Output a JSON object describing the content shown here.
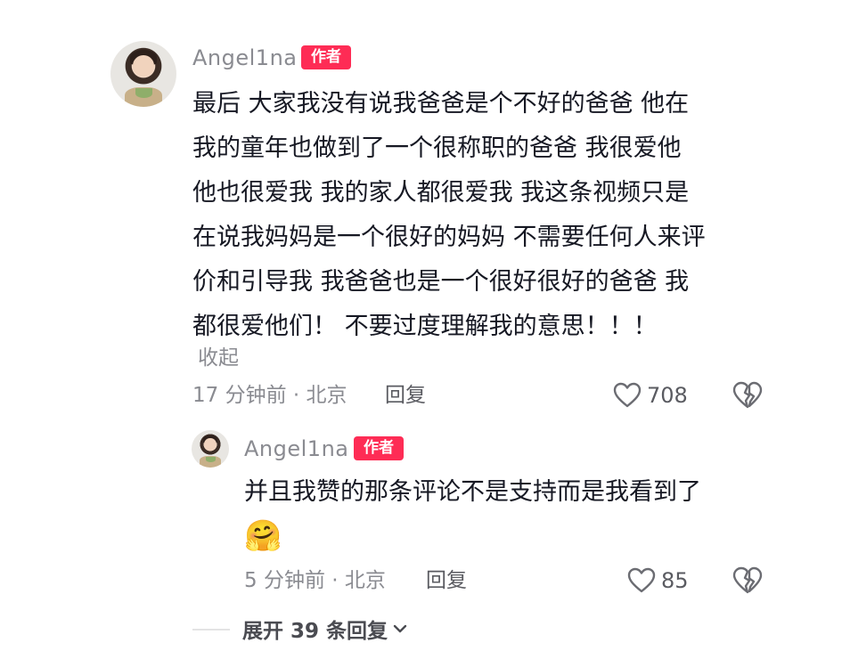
{
  "comment": {
    "username": "Angel1na",
    "badge": "作者",
    "lines": [
      "最后 大家我没有说我爸爸是个不好的爸爸 他在",
      "我的童年也做到了一个很称职的爸爸 我很爱他",
      "他也很爱我 我的家人都很爱我 我这条视频只是",
      "在说我妈妈是一个很好的妈妈 不需要任何人来评",
      "价和引导我 我爸爸也是一个很好很好的爸爸 我",
      "都很爱他们！ 不要过度理解我的意思！！！"
    ],
    "collapse_label": "收起",
    "time_location": "17 分钟前 · 北京",
    "reply_label": "回复",
    "like_count": "708"
  },
  "reply": {
    "username": "Angel1na",
    "badge": "作者",
    "text": "并且我赞的那条评论不是支持而是我看到了",
    "emoji": "🤗",
    "time_location": "5 分钟前 · 北京",
    "reply_label": "回复",
    "like_count": "85"
  },
  "expand": {
    "label": "展开 39 条回复"
  },
  "colors": {
    "badge": "#fe2c55",
    "meta": "#8a8b91",
    "text": "#161823"
  }
}
